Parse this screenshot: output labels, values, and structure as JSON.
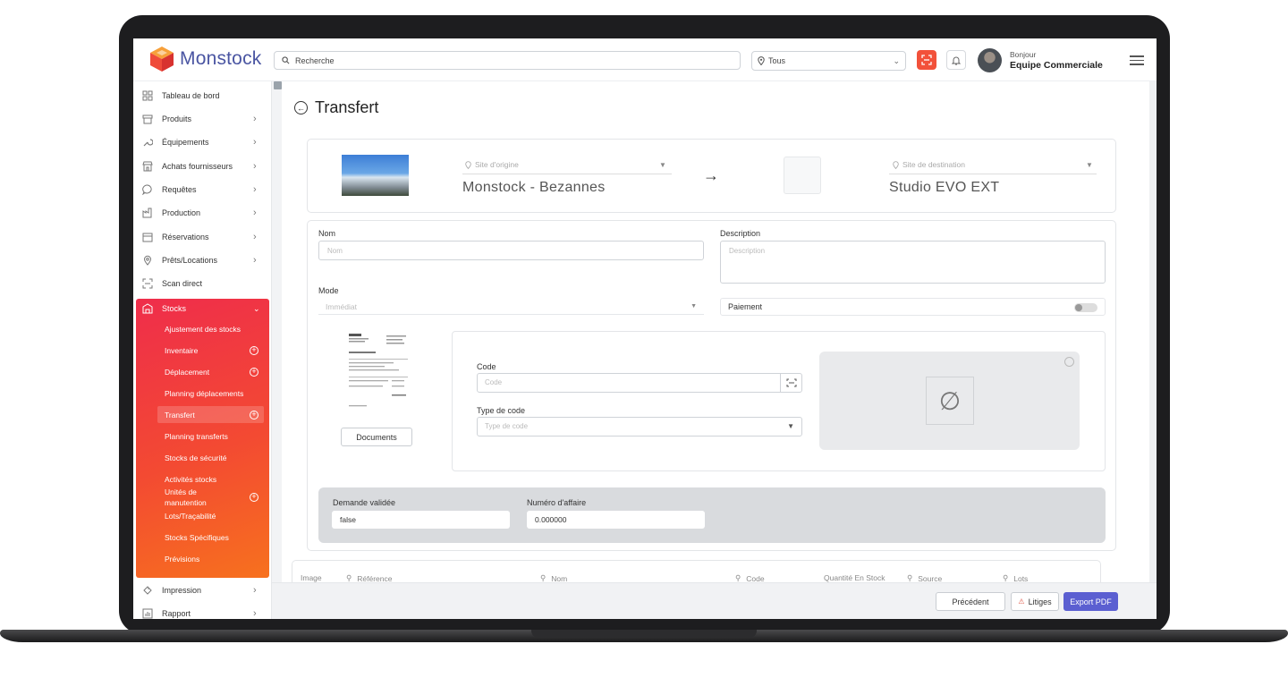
{
  "app": {
    "name": "Monstock"
  },
  "header": {
    "search_placeholder": "Recherche",
    "site_filter": "Tous",
    "greeting": "Bonjour",
    "user_name": "Equipe Commerciale"
  },
  "sidebar": {
    "items": [
      {
        "label": "Tableau de bord",
        "icon": "dashboard-icon"
      },
      {
        "label": "Produits",
        "icon": "box-icon"
      },
      {
        "label": "Équipements",
        "icon": "wrench-icon"
      },
      {
        "label": "Achats fournisseurs",
        "icon": "store-icon"
      },
      {
        "label": "Requêtes",
        "icon": "message-icon"
      },
      {
        "label": "Production",
        "icon": "factory-icon"
      },
      {
        "label": "Réservations",
        "icon": "calendar-icon"
      },
      {
        "label": "Prêts/Locations",
        "icon": "location-icon"
      },
      {
        "label": "Scan direct",
        "icon": "scan-icon"
      }
    ],
    "stocks": {
      "label": "Stocks",
      "subitems": [
        {
          "label": "Ajustement des stocks"
        },
        {
          "label": "Inventaire"
        },
        {
          "label": "Déplacement"
        },
        {
          "label": "Planning déplacements"
        },
        {
          "label": "Transfert"
        },
        {
          "label": "Planning transferts"
        },
        {
          "label": "Stocks de sécurité"
        },
        {
          "label": "Activités stocks"
        },
        {
          "label": "Unités de manutention"
        },
        {
          "label": "Lots/Traçabilité"
        },
        {
          "label": "Stocks Spécifiques"
        },
        {
          "label": "Prévisions"
        }
      ]
    },
    "after": [
      {
        "label": "Impression",
        "icon": "print-icon"
      },
      {
        "label": "Rapport",
        "icon": "report-icon"
      }
    ]
  },
  "page": {
    "title": "Transfert",
    "origin_label": "Site d'origine",
    "origin_name": "Monstock - Bezannes",
    "destination_label": "Site de destination",
    "destination_name": "Studio EVO EXT"
  },
  "form": {
    "nom_label": "Nom",
    "nom_placeholder": "Nom",
    "description_label": "Description",
    "description_placeholder": "Description",
    "mode_label": "Mode",
    "mode_value": "Immédiat",
    "paiement_label": "Paiement",
    "documents_button": "Documents",
    "code_label": "Code",
    "code_placeholder": "Code",
    "type_code_label": "Type de code",
    "type_code_placeholder": "Type de code",
    "demande_label": "Demande validée",
    "demande_value": "false",
    "affaire_label": "Numéro d'affaire",
    "affaire_value": "0.000000"
  },
  "table": {
    "columns": [
      "Image",
      "Référence",
      "Nom",
      "Code",
      "Quantité En Stock",
      "Source",
      "Lots"
    ]
  },
  "footer": {
    "previous": "Précédent",
    "litiges": "Litiges",
    "export": "Export PDF"
  },
  "colors": {
    "accent": "#f2513a",
    "primary": "#5b5fd1",
    "brand": "#4a55a2"
  }
}
